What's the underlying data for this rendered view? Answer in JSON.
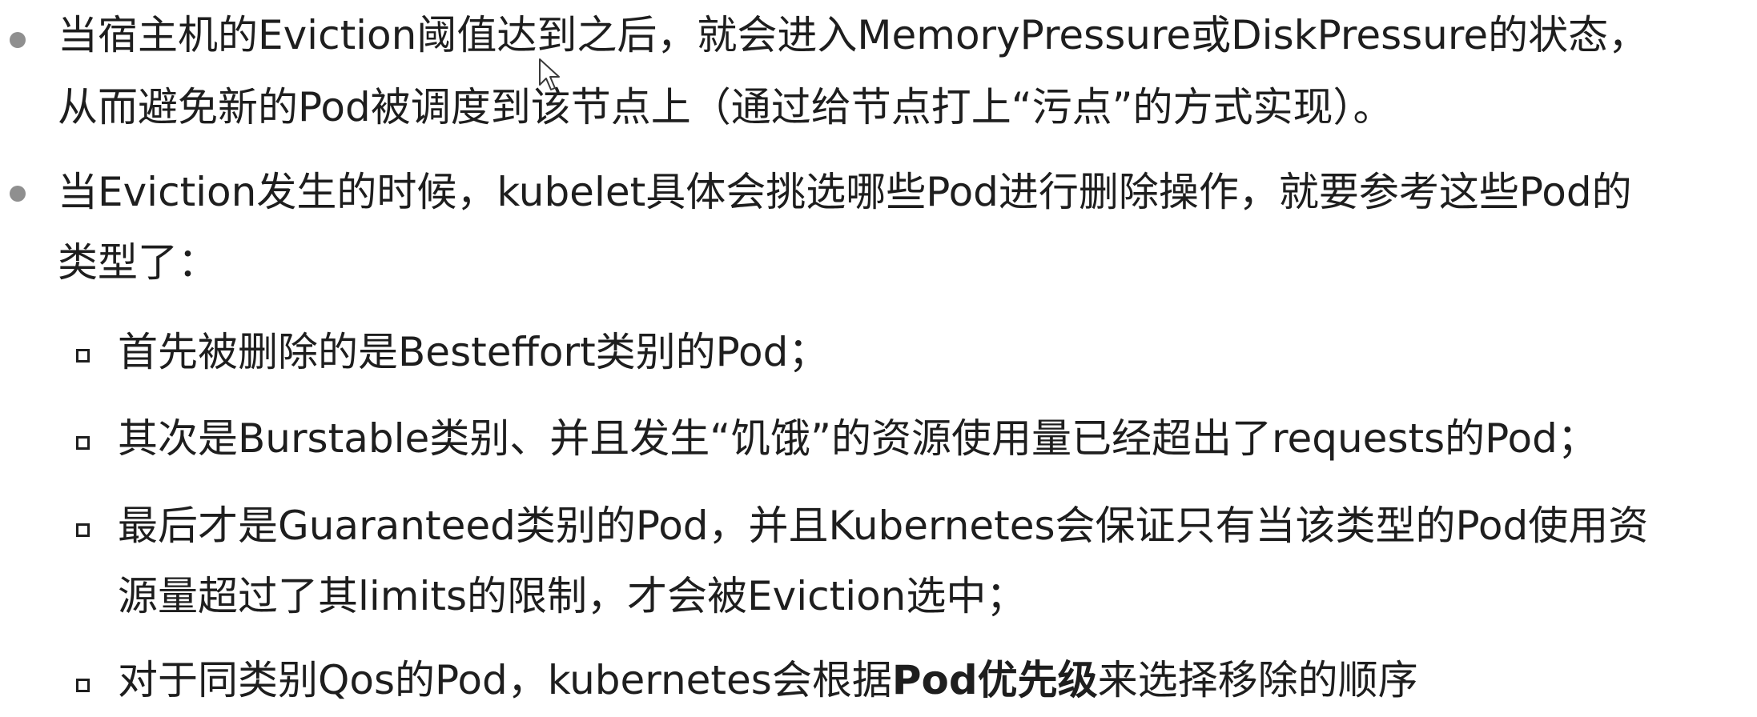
{
  "bullets": [
    {
      "lines": [
        "当宿主机的Eviction阈值达到之后，就会进入MemoryPressure或DiskPressure的状态，",
        "从而避免新的Pod被调度到该节点上（通过给节点打上“污点”的方式实现）。"
      ]
    },
    {
      "lines": [
        "当Eviction发生的时候，kubelet具体会挑选哪些Pod进行删除操作，就要参考这些Pod的",
        "类型了："
      ]
    }
  ],
  "subitems": [
    {
      "lines": [
        "首先被删除的是Besteffort类别的Pod；"
      ]
    },
    {
      "lines": [
        "其次是Burstable类别、并且发生“饥饿”的资源使用量已经超出了requests的Pod；"
      ]
    },
    {
      "lines": [
        "最后才是Guaranteed类别的Pod，并且Kubernetes会保证只有当该类型的Pod使用资",
        "源量超过了其limits的限制，才会被Eviction选中；"
      ]
    },
    {
      "prefix": "对于同类别Qos的Pod，kubernetes会根据",
      "bold": "Pod优先级",
      "suffix": "来选择移除的顺序"
    }
  ]
}
